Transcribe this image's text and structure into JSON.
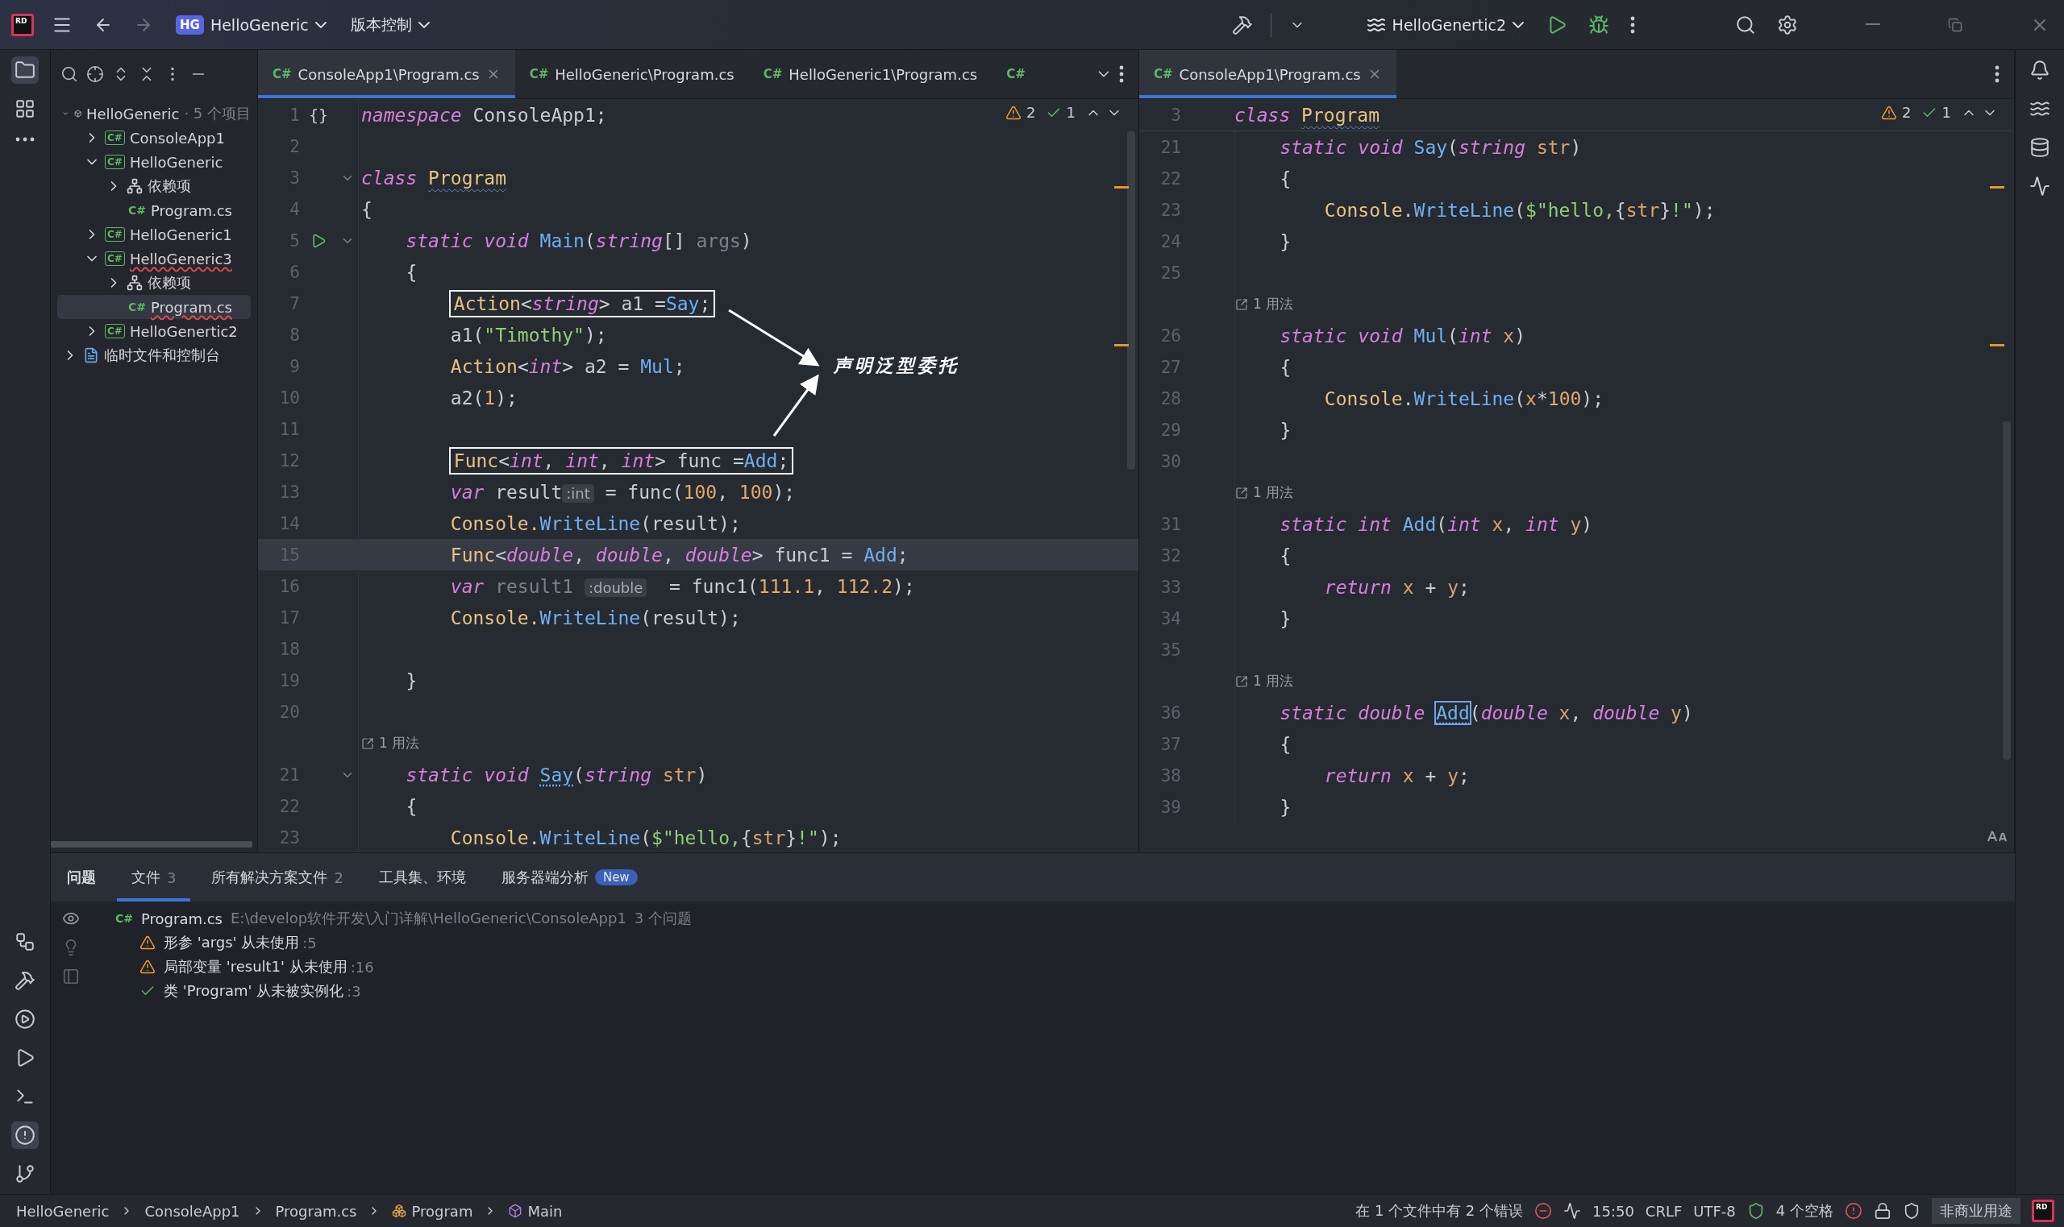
{
  "title_bar": {
    "logo": "RD",
    "project_badge": "HG",
    "project": "HelloGeneric",
    "vcs": "版本控制",
    "run_config": "HelloGenertic2"
  },
  "project_tree": {
    "items": [
      {
        "kind": "solution",
        "label": "HelloGeneric",
        "note": "· 5 个项目",
        "expanded": true,
        "selected": false,
        "children": [
          {
            "kind": "project",
            "badge": "C#",
            "label": "ConsoleApp1",
            "expanded": false,
            "selected": false
          },
          {
            "kind": "project",
            "badge": "C#",
            "label": "HelloGeneric",
            "expanded": true,
            "selected": false,
            "children": [
              {
                "kind": "deps",
                "label": "依赖项",
                "expanded": false,
                "selected": false
              },
              {
                "kind": "file",
                "badge": "C#",
                "label": "Program.cs",
                "selected": false
              }
            ]
          },
          {
            "kind": "project",
            "badge": "C#",
            "label": "HelloGeneric1",
            "expanded": false,
            "selected": false
          },
          {
            "kind": "project",
            "badge": "C#",
            "label": "HelloGeneric3",
            "expanded": true,
            "selected": false,
            "error": true,
            "children": [
              {
                "kind": "deps",
                "label": "依赖项",
                "expanded": false,
                "selected": false
              },
              {
                "kind": "file",
                "badge": "C#",
                "label": "Program.cs",
                "selected": true,
                "error": true
              }
            ]
          },
          {
            "kind": "project",
            "badge": "C#",
            "label": "HelloGenertic2",
            "expanded": false,
            "selected": false
          }
        ]
      },
      {
        "kind": "scratch",
        "label": "临时文件和控制台",
        "expanded": false,
        "selected": false
      }
    ]
  },
  "left_editor": {
    "tabs": [
      {
        "badge": "C#",
        "label": "ConsoleApp1\\Program.cs",
        "selected": true,
        "closable": true
      },
      {
        "badge": "C#",
        "label": "HelloGeneric\\Program.cs",
        "selected": false,
        "closable": false
      },
      {
        "badge": "C#",
        "label": "HelloGeneric1\\Program.cs",
        "selected": false,
        "closable": false
      },
      {
        "badge": "C#",
        "selected": false,
        "closable": false
      }
    ],
    "inspections": {
      "warnings": "2",
      "ok": "1"
    },
    "annotation": {
      "text": "声明泛型委托"
    },
    "lines": [
      {
        "no": "1",
        "gutter": "{}",
        "tokens": [
          {
            "text": "namespace ",
            "kind": "kw"
          },
          {
            "text": "ConsoleApp1;",
            "kind": "plain"
          }
        ]
      },
      {
        "no": "2"
      },
      {
        "no": "3",
        "fold": true,
        "tokens": [
          {
            "text": "class ",
            "kind": "kw"
          },
          {
            "text": "Program",
            "kind": "cls-warn"
          }
        ]
      },
      {
        "no": "4",
        "tokens": [
          {
            "text": "{",
            "kind": "plain"
          }
        ]
      },
      {
        "no": "5",
        "run": true,
        "fold": true,
        "tokens": [
          {
            "text": "    static void ",
            "kind": "kw"
          },
          {
            "text": "Main",
            "kind": "fn"
          },
          {
            "text": "(",
            "kind": "plain"
          },
          {
            "text": "string",
            "kind": "kw"
          },
          {
            "text": "[] ",
            "kind": "plain"
          },
          {
            "text": "args",
            "kind": "unused"
          },
          {
            "text": ")",
            "kind": "plain"
          }
        ]
      },
      {
        "no": "6",
        "tokens": [
          {
            "text": "    {",
            "kind": "plain"
          }
        ]
      },
      {
        "no": "7",
        "boxed": true,
        "tokens": [
          {
            "text": "        Action",
            "kind": "cls"
          },
          {
            "text": "<",
            "kind": "plain"
          },
          {
            "text": "string",
            "kind": "kw"
          },
          {
            "text": "> a1 =",
            "kind": "plain"
          },
          {
            "text": "Say",
            "kind": "fn"
          },
          {
            "text": ";",
            "kind": "plain"
          }
        ]
      },
      {
        "no": "8",
        "tokens": [
          {
            "text": "        a1(",
            "kind": "plain"
          },
          {
            "text": "\"Timothy\"",
            "kind": "str"
          },
          {
            "text": ");",
            "kind": "plain"
          }
        ]
      },
      {
        "no": "9",
        "tokens": [
          {
            "text": "        Action",
            "kind": "cls"
          },
          {
            "text": "<",
            "kind": "plain"
          },
          {
            "text": "int",
            "kind": "kw"
          },
          {
            "text": "> a2 = ",
            "kind": "plain"
          },
          {
            "text": "Mul",
            "kind": "fn"
          },
          {
            "text": ";",
            "kind": "plain"
          }
        ]
      },
      {
        "no": "10",
        "tokens": [
          {
            "text": "        a2(",
            "kind": "plain"
          },
          {
            "text": "1",
            "kind": "num"
          },
          {
            "text": ");",
            "kind": "plain"
          }
        ]
      },
      {
        "no": "11"
      },
      {
        "no": "12",
        "boxed": true,
        "tokens": [
          {
            "text": "        Func",
            "kind": "cls"
          },
          {
            "text": "<",
            "kind": "plain"
          },
          {
            "text": "int",
            "kind": "kw"
          },
          {
            "text": ", ",
            "kind": "plain"
          },
          {
            "text": "int",
            "kind": "kw"
          },
          {
            "text": ", ",
            "kind": "plain"
          },
          {
            "text": "int",
            "kind": "kw"
          },
          {
            "text": "> func =",
            "kind": "plain"
          },
          {
            "text": "Add",
            "kind": "fn"
          },
          {
            "text": ";",
            "kind": "plain"
          }
        ]
      },
      {
        "no": "13",
        "tokens": [
          {
            "text": "        var ",
            "kind": "kw"
          },
          {
            "text": "result",
            "kind": "plain"
          },
          {
            "text": ":int",
            "kind": "hint"
          },
          {
            "text": " = func(",
            "kind": "plain"
          },
          {
            "text": "100",
            "kind": "num"
          },
          {
            "text": ", ",
            "kind": "plain"
          },
          {
            "text": "100",
            "kind": "num"
          },
          {
            "text": ");",
            "kind": "plain"
          }
        ]
      },
      {
        "no": "14",
        "tokens": [
          {
            "text": "        Console.",
            "kind": "cls"
          },
          {
            "text": "WriteLine",
            "kind": "fn"
          },
          {
            "text": "(result);",
            "kind": "plain"
          }
        ]
      },
      {
        "no": "15",
        "current": true,
        "tokens": [
          {
            "text": "        Func",
            "kind": "cls"
          },
          {
            "text": "<",
            "kind": "plain"
          },
          {
            "text": "double",
            "kind": "kw"
          },
          {
            "text": ", ",
            "kind": "plain"
          },
          {
            "text": "double",
            "kind": "kw"
          },
          {
            "text": ", ",
            "kind": "plain"
          },
          {
            "text": "double",
            "kind": "kw"
          },
          {
            "text": "> func1 = ",
            "kind": "plain"
          },
          {
            "text": "Add",
            "kind": "fn"
          },
          {
            "text": ";",
            "kind": "plain"
          }
        ]
      },
      {
        "no": "16",
        "tokens": [
          {
            "text": "        var ",
            "kind": "kw"
          },
          {
            "text": "result1 ",
            "kind": "unused"
          },
          {
            "text": ":double",
            "kind": "hint"
          },
          {
            "text": "  = func1(",
            "kind": "plain"
          },
          {
            "text": "111.1",
            "kind": "num"
          },
          {
            "text": ", ",
            "kind": "plain"
          },
          {
            "text": "112.2",
            "kind": "num"
          },
          {
            "text": ");",
            "kind": "plain"
          }
        ]
      },
      {
        "no": "17",
        "tokens": [
          {
            "text": "        Console.",
            "kind": "cls"
          },
          {
            "text": "WriteLine",
            "kind": "fn"
          },
          {
            "text": "(result);",
            "kind": "plain"
          }
        ]
      },
      {
        "no": "18"
      },
      {
        "no": "19",
        "tokens": [
          {
            "text": "    }",
            "kind": "plain"
          }
        ]
      },
      {
        "no": "20"
      },
      {
        "no": "21",
        "usage": "1 用法",
        "fold": true,
        "tokens": [
          {
            "text": "    static void ",
            "kind": "kw"
          },
          {
            "text": "Say",
            "kind": "fn-dot"
          },
          {
            "text": "(",
            "kind": "plain"
          },
          {
            "text": "string ",
            "kind": "kw"
          },
          {
            "text": "str",
            "kind": "param"
          },
          {
            "text": ")",
            "kind": "plain"
          }
        ]
      },
      {
        "no": "22",
        "tokens": [
          {
            "text": "    {",
            "kind": "plain"
          }
        ]
      },
      {
        "no": "23",
        "tokens": [
          {
            "text": "        Console",
            "kind": "cls"
          },
          {
            "text": ".",
            "kind": "plain"
          },
          {
            "text": "WriteLine",
            "kind": "fn"
          },
          {
            "text": "(",
            "kind": "plain"
          },
          {
            "text": "$\"hello,",
            "kind": "str"
          },
          {
            "text": "{",
            "kind": "plain"
          },
          {
            "text": "str",
            "kind": "param"
          },
          {
            "text": "}",
            "kind": "plain"
          },
          {
            "text": "!\"",
            "kind": "str"
          },
          {
            "text": ");",
            "kind": "plain"
          }
        ]
      }
    ]
  },
  "right_editor": {
    "tabs": [
      {
        "badge": "C#",
        "label": "ConsoleApp1\\Program.cs",
        "selected": true,
        "closable": true
      }
    ],
    "inspections": {
      "warnings": "2",
      "ok": "1"
    },
    "sticky": {
      "no": "3",
      "tokens": [
        {
          "text": "class ",
          "kind": "kw"
        },
        {
          "text": "Program",
          "kind": "cls-warn"
        }
      ]
    },
    "lines": [
      {
        "no": "21",
        "tokens": [
          {
            "text": "    static void ",
            "kind": "kw"
          },
          {
            "text": "Say",
            "kind": "fn"
          },
          {
            "text": "(",
            "kind": "plain"
          },
          {
            "text": "string ",
            "kind": "kw"
          },
          {
            "text": "str",
            "kind": "param"
          },
          {
            "text": ")",
            "kind": "plain"
          }
        ]
      },
      {
        "no": "22",
        "tokens": [
          {
            "text": "    {",
            "kind": "plain"
          }
        ]
      },
      {
        "no": "23",
        "tokens": [
          {
            "text": "        Console",
            "kind": "cls"
          },
          {
            "text": ".",
            "kind": "plain"
          },
          {
            "text": "WriteLine",
            "kind": "fn"
          },
          {
            "text": "(",
            "kind": "plain"
          },
          {
            "text": "$\"hello,",
            "kind": "str"
          },
          {
            "text": "{",
            "kind": "plain"
          },
          {
            "text": "str",
            "kind": "param"
          },
          {
            "text": "}",
            "kind": "plain"
          },
          {
            "text": "!\"",
            "kind": "str"
          },
          {
            "text": ");",
            "kind": "plain"
          }
        ]
      },
      {
        "no": "24",
        "tokens": [
          {
            "text": "    }",
            "kind": "plain"
          }
        ]
      },
      {
        "no": "25"
      },
      {
        "no": "26",
        "usage": "1 用法",
        "tokens": [
          {
            "text": "    static void ",
            "kind": "kw"
          },
          {
            "text": "Mul",
            "kind": "fn"
          },
          {
            "text": "(",
            "kind": "plain"
          },
          {
            "text": "int ",
            "kind": "kw"
          },
          {
            "text": "x",
            "kind": "param"
          },
          {
            "text": ")",
            "kind": "plain"
          }
        ]
      },
      {
        "no": "27",
        "tokens": [
          {
            "text": "    {",
            "kind": "plain"
          }
        ]
      },
      {
        "no": "28",
        "tokens": [
          {
            "text": "        Console",
            "kind": "cls"
          },
          {
            "text": ".",
            "kind": "plain"
          },
          {
            "text": "WriteLine",
            "kind": "fn"
          },
          {
            "text": "(",
            "kind": "plain"
          },
          {
            "text": "x",
            "kind": "param"
          },
          {
            "text": "*",
            "kind": "plain"
          },
          {
            "text": "100",
            "kind": "num"
          },
          {
            "text": ");",
            "kind": "plain"
          }
        ]
      },
      {
        "no": "29",
        "tokens": [
          {
            "text": "    }",
            "kind": "plain"
          }
        ]
      },
      {
        "no": "30"
      },
      {
        "no": "31",
        "usage": "1 用法",
        "tokens": [
          {
            "text": "    static int ",
            "kind": "kw"
          },
          {
            "text": "Add",
            "kind": "fn"
          },
          {
            "text": "(",
            "kind": "plain"
          },
          {
            "text": "int ",
            "kind": "kw"
          },
          {
            "text": "x",
            "kind": "param"
          },
          {
            "text": ", ",
            "kind": "plain"
          },
          {
            "text": "int ",
            "kind": "kw"
          },
          {
            "text": "y",
            "kind": "param"
          },
          {
            "text": ")",
            "kind": "plain"
          }
        ]
      },
      {
        "no": "32",
        "tokens": [
          {
            "text": "    {",
            "kind": "plain"
          }
        ]
      },
      {
        "no": "33",
        "tokens": [
          {
            "text": "        return ",
            "kind": "kw"
          },
          {
            "text": "x",
            "kind": "param"
          },
          {
            "text": " + ",
            "kind": "plain"
          },
          {
            "text": "y",
            "kind": "param"
          },
          {
            "text": ";",
            "kind": "plain"
          }
        ]
      },
      {
        "no": "34",
        "tokens": [
          {
            "text": "    }",
            "kind": "plain"
          }
        ]
      },
      {
        "no": "35"
      },
      {
        "no": "36",
        "usage": "1 用法",
        "tokens": [
          {
            "text": "    static double ",
            "kind": "kw"
          },
          {
            "text": "Add",
            "kind": "fn-focus"
          },
          {
            "text": "(",
            "kind": "plain"
          },
          {
            "text": "double ",
            "kind": "kw"
          },
          {
            "text": "x",
            "kind": "param"
          },
          {
            "text": ", ",
            "kind": "plain"
          },
          {
            "text": "double ",
            "kind": "kw"
          },
          {
            "text": "y",
            "kind": "param"
          },
          {
            "text": ")",
            "kind": "plain"
          }
        ]
      },
      {
        "no": "37",
        "tokens": [
          {
            "text": "    {",
            "kind": "plain"
          }
        ]
      },
      {
        "no": "38",
        "tokens": [
          {
            "text": "        return ",
            "kind": "kw"
          },
          {
            "text": "x",
            "kind": "param"
          },
          {
            "text": " + ",
            "kind": "plain"
          },
          {
            "text": "y",
            "kind": "param"
          },
          {
            "text": ";",
            "kind": "plain"
          }
        ]
      },
      {
        "no": "39",
        "tokens": [
          {
            "text": "    }",
            "kind": "plain"
          }
        ]
      }
    ]
  },
  "problems_panel": {
    "title": "问题",
    "tabs": [
      {
        "label": "文件",
        "count": "3",
        "selected": true
      },
      {
        "label": "所有解决方案文件",
        "count": "2",
        "selected": false
      },
      {
        "label": "工具集、环境",
        "selected": false
      },
      {
        "label": "服务器端分析",
        "badge": "New",
        "selected": false
      }
    ],
    "file": {
      "badge": "C#",
      "name": "Program.cs",
      "path": "E:\\develop软件开发\\入门详解\\HelloGeneric\\ConsoleApp1",
      "summary": "3 个问题"
    },
    "problems": [
      {
        "kind": "warning",
        "text": "形参 'args' 从未使用",
        "line": ":5"
      },
      {
        "kind": "warning",
        "text": "局部变量 'result1' 从未使用",
        "line": ":16"
      },
      {
        "kind": "ok",
        "text": "类 'Program' 从未被实例化",
        "line": ":3"
      }
    ]
  },
  "status_bar": {
    "breadcrumbs": [
      {
        "kind": "plain",
        "label": "HelloGeneric"
      },
      {
        "kind": "plain",
        "label": "ConsoleApp1"
      },
      {
        "kind": "plain",
        "label": "Program.cs"
      },
      {
        "kind": "class",
        "label": "Program"
      },
      {
        "kind": "method",
        "label": "Main"
      }
    ],
    "errors": "在 1 个文件中有 2 个错误",
    "position": "15:50",
    "line_ending": "CRLF",
    "encoding": "UTF-8",
    "indent": "4 个空格",
    "license": "非商业用途",
    "logo": "RD"
  }
}
